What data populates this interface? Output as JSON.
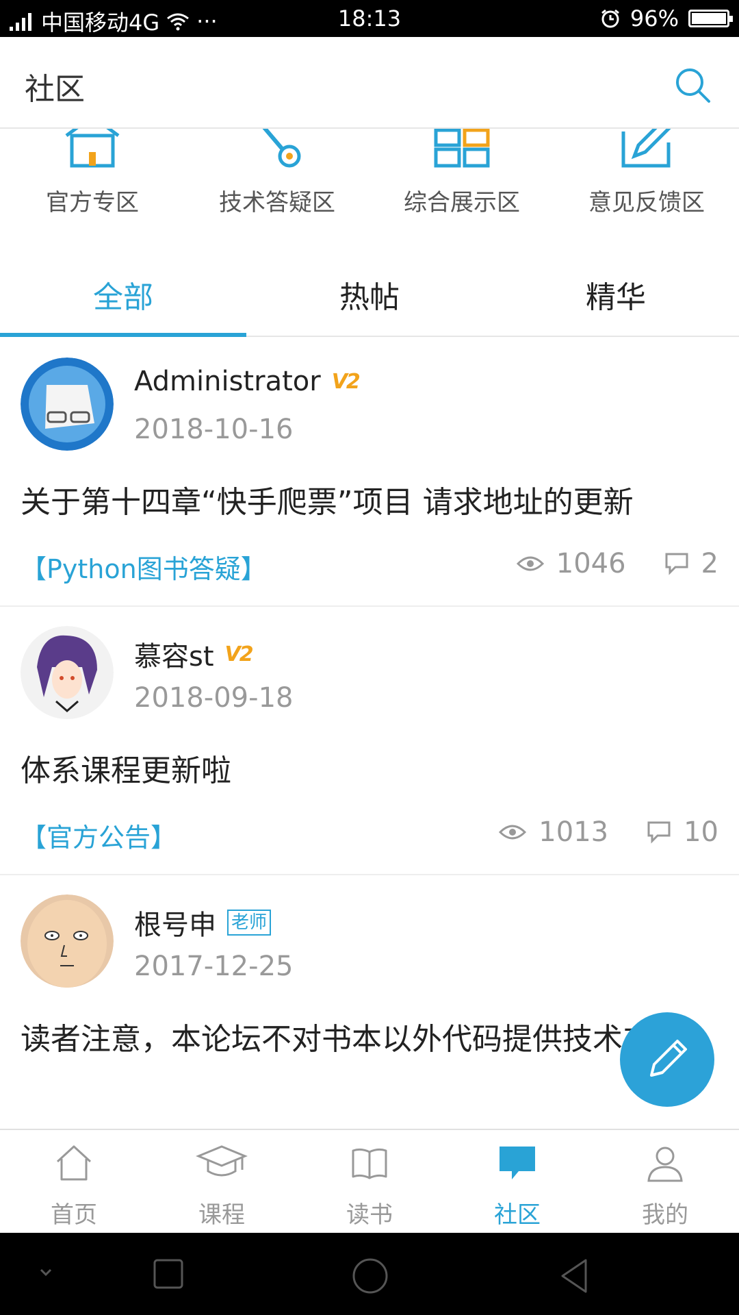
{
  "status_bar": {
    "carrier": "中国移动4G",
    "more": "···",
    "time": "18:13",
    "battery": "96%"
  },
  "header": {
    "title": "社区"
  },
  "categories": [
    {
      "label": "官方专区",
      "icon": "house-icon"
    },
    {
      "label": "技术答疑区",
      "icon": "wrench-icon"
    },
    {
      "label": "综合展示区",
      "icon": "grid-icon"
    },
    {
      "label": "意见反馈区",
      "icon": "edit-icon"
    }
  ],
  "tabs": [
    {
      "label": "全部"
    },
    {
      "label": "热帖"
    },
    {
      "label": "精华"
    }
  ],
  "posts": [
    {
      "author": "Administrator",
      "badge": "V2",
      "date": "2018-10-16",
      "title": "关于第十四章“快手爬票”项目 请求地址的更新",
      "tag": "【Python图书答疑】",
      "views": "1046",
      "comments": "2"
    },
    {
      "author": "慕容st",
      "badge": "V2",
      "date": "2018-09-18",
      "title": "体系课程更新啦",
      "tag": "【官方公告】",
      "views": "1013",
      "comments": "10"
    },
    {
      "author": "根号申",
      "badge": "老师",
      "date": "2017-12-25",
      "title": "读者注意，本论坛不对书本以外代码提供技术支持！",
      "tag": "",
      "views": "",
      "comments": ""
    }
  ],
  "bottom_nav": [
    {
      "label": "首页",
      "icon": "home-icon"
    },
    {
      "label": "课程",
      "icon": "graduation-cap-icon"
    },
    {
      "label": "读书",
      "icon": "book-icon"
    },
    {
      "label": "社区",
      "icon": "chat-bubble-icon"
    },
    {
      "label": "我的",
      "icon": "person-icon"
    }
  ],
  "colors": {
    "accent": "#29a3d6",
    "badge": "#f2a31b",
    "muted": "#999999"
  }
}
